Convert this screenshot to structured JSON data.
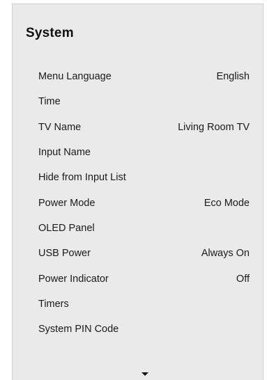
{
  "header": {
    "title": "System"
  },
  "menu": [
    {
      "label": "Menu Language",
      "value": "English"
    },
    {
      "label": "Time",
      "value": ""
    },
    {
      "label": "TV Name",
      "value": "Living Room TV"
    },
    {
      "label": "Input Name",
      "value": ""
    },
    {
      "label": "Hide from Input List",
      "value": ""
    },
    {
      "label": "Power Mode",
      "value": "Eco Mode"
    },
    {
      "label": "OLED Panel",
      "value": ""
    },
    {
      "label": "USB Power",
      "value": "Always On"
    },
    {
      "label": "Power Indicator",
      "value": "Off"
    },
    {
      "label": "Timers",
      "value": ""
    },
    {
      "label": "System PIN Code",
      "value": ""
    }
  ],
  "icons": {
    "scroll_more": "chevron-down-icon"
  },
  "colors": {
    "panel_bg": "#eaeaea",
    "text": "#1a1a1a"
  }
}
